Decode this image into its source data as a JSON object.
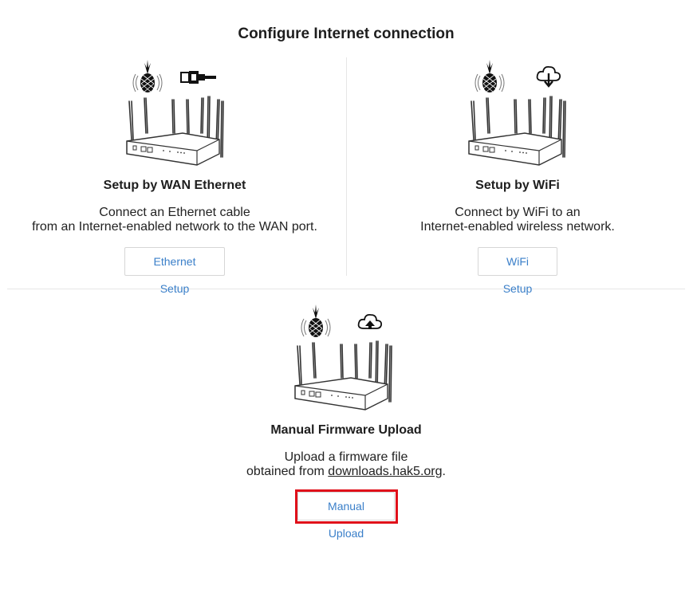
{
  "page": {
    "title": "Configure Internet connection"
  },
  "ethernet": {
    "title": "Setup by WAN Ethernet",
    "desc_line1": "Connect an Ethernet cable",
    "desc_line2": "from an Internet-enabled network to the WAN port.",
    "button_label": "Ethernet Setup",
    "icon": "ethernet-cable-icon"
  },
  "wifi": {
    "title": "Setup by WiFi",
    "desc_line1": "Connect by WiFi to an",
    "desc_line2": "Internet-enabled wireless network.",
    "button_label": "WiFi Setup",
    "icon": "cloud-download-icon"
  },
  "manual": {
    "title": "Manual Firmware Upload",
    "desc_line1": "Upload a firmware file",
    "desc_prefix": "obtained from ",
    "desc_link": "downloads.hak5.org",
    "desc_suffix": ".",
    "button_label": "Manual Upload",
    "icon": "cloud-upload-icon"
  },
  "colors": {
    "button_text": "#3a7fc9",
    "highlight": "#e0101a"
  }
}
